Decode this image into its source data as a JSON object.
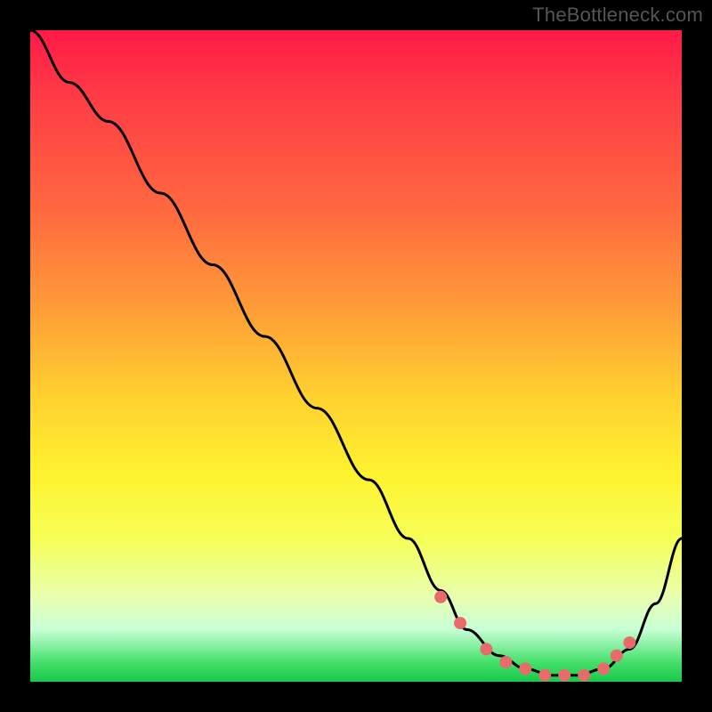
{
  "watermark": "TheBottleneck.com",
  "chart_data": {
    "type": "line",
    "title": "",
    "xlabel": "",
    "ylabel": "",
    "xlim": [
      0,
      100
    ],
    "ylim": [
      0,
      100
    ],
    "grid": false,
    "legend": false,
    "series": [
      {
        "name": "bottleneck-curve",
        "x": [
          0,
          6,
          12,
          20,
          28,
          36,
          44,
          52,
          58,
          63,
          67,
          72,
          76,
          80,
          84,
          88,
          92,
          96,
          100
        ],
        "y": [
          100,
          92,
          86,
          75,
          64,
          53,
          42,
          31,
          22,
          14,
          8,
          4,
          2,
          1,
          1,
          2,
          5,
          12,
          22
        ]
      }
    ],
    "markers": {
      "name": "highlight-dots",
      "color": "#e76b6b",
      "x": [
        63,
        66,
        70,
        73,
        76,
        79,
        82,
        85,
        88,
        90,
        92
      ],
      "y": [
        13,
        9,
        5,
        3,
        2,
        1,
        1,
        1,
        2,
        4,
        6
      ]
    }
  }
}
